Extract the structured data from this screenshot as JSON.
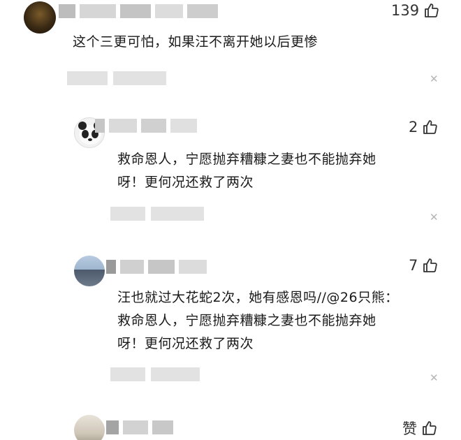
{
  "comments": [
    {
      "text": "这个三更可怕，如果汪不离开她以后更惨",
      "likes": "139",
      "like_icon": "thumbs-up-icon",
      "close_icon": "close-icon"
    },
    {
      "text_lines": [
        "救命恩人，宁愿抛弃糟糠之妻也不能抛弃她",
        "呀！更何况还救了两次"
      ],
      "likes": "2",
      "like_icon": "thumbs-up-icon",
      "close_icon": "close-icon"
    },
    {
      "text_lines": [
        "汪也就过大花蛇2次，她有感恩吗//@26只熊：",
        "救命恩人，宁愿抛弃糟糠之妻也不能抛弃她",
        "呀！更何况还救了两次"
      ],
      "likes": "7",
      "like_icon": "thumbs-up-icon",
      "close_icon": "close-icon"
    },
    {
      "likes": "赞",
      "like_icon": "thumbs-up-icon"
    }
  ]
}
